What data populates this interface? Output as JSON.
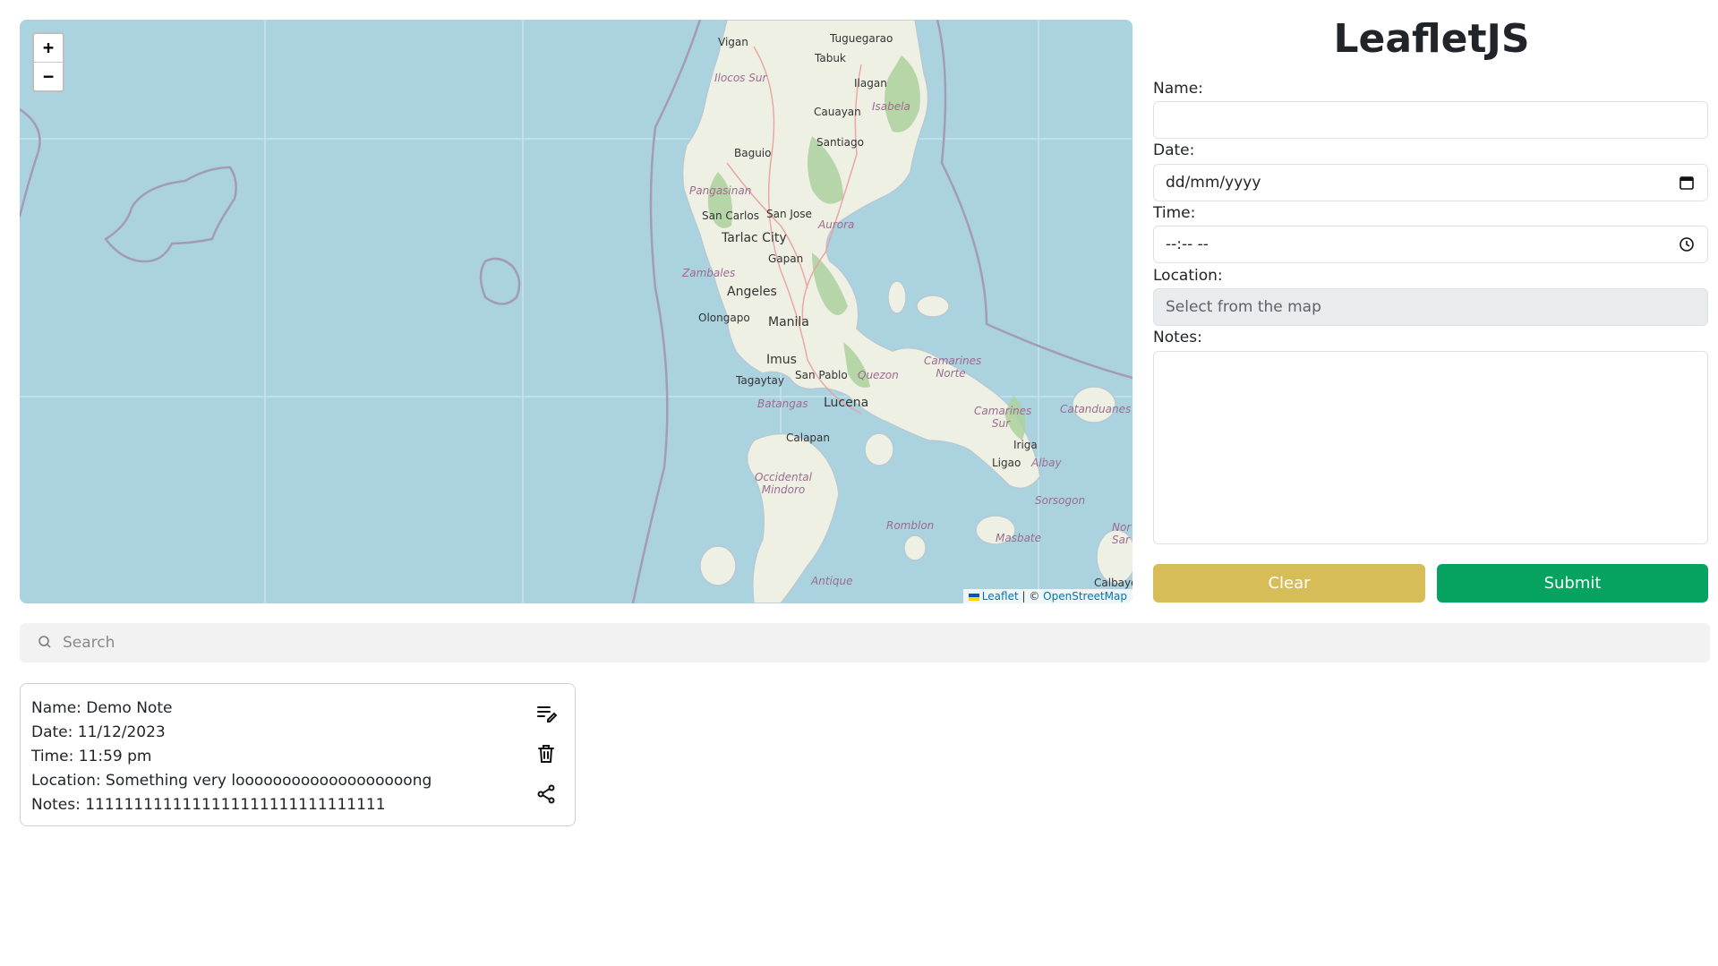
{
  "map": {
    "zoom_in": "+",
    "zoom_out": "−",
    "attribution": {
      "leaflet": "Leaflet",
      "sep": " | © ",
      "osm": "OpenStreetMap"
    },
    "towns": [
      {
        "name": "Vigan"
      },
      {
        "name": "Tuguegarao"
      },
      {
        "name": "Tabuk"
      },
      {
        "name": "Ilagan"
      },
      {
        "name": "Cauayan"
      },
      {
        "name": "Santiago"
      },
      {
        "name": "Baguio"
      },
      {
        "name": "San Carlos"
      },
      {
        "name": "San Jose"
      },
      {
        "name": "Tarlac City"
      },
      {
        "name": "Gapan"
      },
      {
        "name": "Angeles"
      },
      {
        "name": "Olongapo"
      },
      {
        "name": "Manila"
      },
      {
        "name": "Imus"
      },
      {
        "name": "Tagaytay"
      },
      {
        "name": "San Pablo"
      },
      {
        "name": "Lucena"
      },
      {
        "name": "Calapan"
      },
      {
        "name": "Iriga"
      },
      {
        "name": "Ligao"
      },
      {
        "name": "Calbayo"
      }
    ],
    "provinces": [
      {
        "name": "Ilocos Sur"
      },
      {
        "name": "Isabela"
      },
      {
        "name": "Pangasinan"
      },
      {
        "name": "Aurora"
      },
      {
        "name": "Zambales"
      },
      {
        "name": "Quezon"
      },
      {
        "name": "Batangas"
      },
      {
        "name": "Camarines Norte"
      },
      {
        "name": "Camarines Sur"
      },
      {
        "name": "Catanduanes"
      },
      {
        "name": "Albay"
      },
      {
        "name": "Occidental Mindoro"
      },
      {
        "name": "Romblon"
      },
      {
        "name": "Masbate"
      },
      {
        "name": "Sorsogon"
      },
      {
        "name": "Antique"
      },
      {
        "name": "Nor Sar"
      }
    ]
  },
  "form": {
    "title": "LeafletJS",
    "name_label": "Name:",
    "date_label": "Date:",
    "date_placeholder": "dd/mm/yyyy",
    "time_label": "Time:",
    "time_placeholder": "--:-- --",
    "location_label": "Location:",
    "location_placeholder": "Select from the map",
    "notes_label": "Notes:",
    "clear_label": "Clear",
    "submit_label": "Submit"
  },
  "search": {
    "placeholder": "Search"
  },
  "note": {
    "name": "Name: Demo Note",
    "date": "Date: 11/12/2023",
    "time": "Time: 11:59 pm",
    "location": "Location: Something very looooooooooooooooooong",
    "notes": "Notes: 1111111111111111111111111111111"
  },
  "colors": {
    "water": "#aad3df",
    "land": "#f2efe9",
    "clear": "#d7bd58",
    "submit": "#05a35f"
  }
}
